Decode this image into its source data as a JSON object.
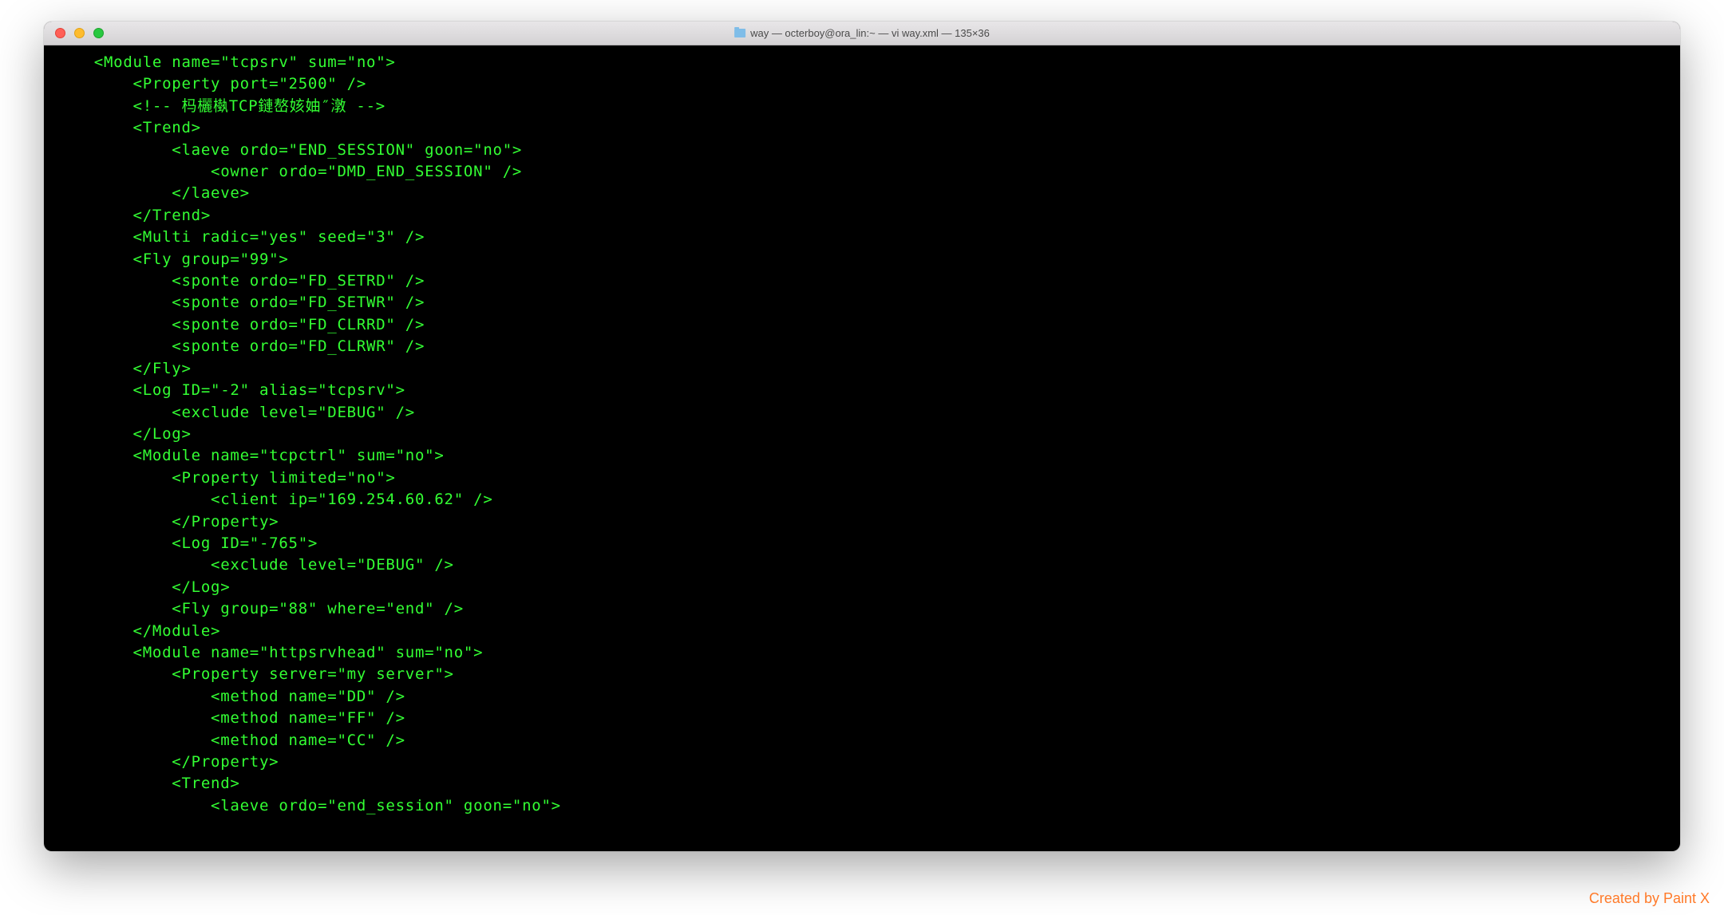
{
  "window": {
    "title": "way — octerboy@ora_lin:~ — vi way.xml — 135×36"
  },
  "terminal": {
    "lines": [
      "    <Module name=\"tcpsrv\" sum=\"no\">",
      "        <Property port=\"2500\" />",
      "        <!-- 杩欐槸TCP鏈嶅姟妯″潡 -->",
      "        <Trend>",
      "            <laeve ordo=\"END_SESSION\" goon=\"no\">",
      "                <owner ordo=\"DMD_END_SESSION\" />",
      "            </laeve>",
      "        </Trend>",
      "        <Multi radic=\"yes\" seed=\"3\" />",
      "        <Fly group=\"99\">",
      "            <sponte ordo=\"FD_SETRD\" />",
      "            <sponte ordo=\"FD_SETWR\" />",
      "            <sponte ordo=\"FD_CLRRD\" />",
      "            <sponte ordo=\"FD_CLRWR\" />",
      "        </Fly>",
      "        <Log ID=\"-2\" alias=\"tcpsrv\">",
      "            <exclude level=\"DEBUG\" />",
      "        </Log>",
      "        <Module name=\"tcpctrl\" sum=\"no\">",
      "            <Property limited=\"no\">",
      "                <client ip=\"169.254.60.62\" />",
      "            </Property>",
      "            <Log ID=\"-765\">",
      "                <exclude level=\"DEBUG\" />",
      "            </Log>",
      "            <Fly group=\"88\" where=\"end\" />",
      "        </Module>",
      "        <Module name=\"httpsrvhead\" sum=\"no\">",
      "            <Property server=\"my server\">",
      "                <method name=\"DD\" />",
      "                <method name=\"FF\" />",
      "                <method name=\"CC\" />",
      "            </Property>",
      "            <Trend>",
      "                <laeve ordo=\"end_session\" goon=\"no\">"
    ]
  },
  "watermark": "Created by Paint X"
}
